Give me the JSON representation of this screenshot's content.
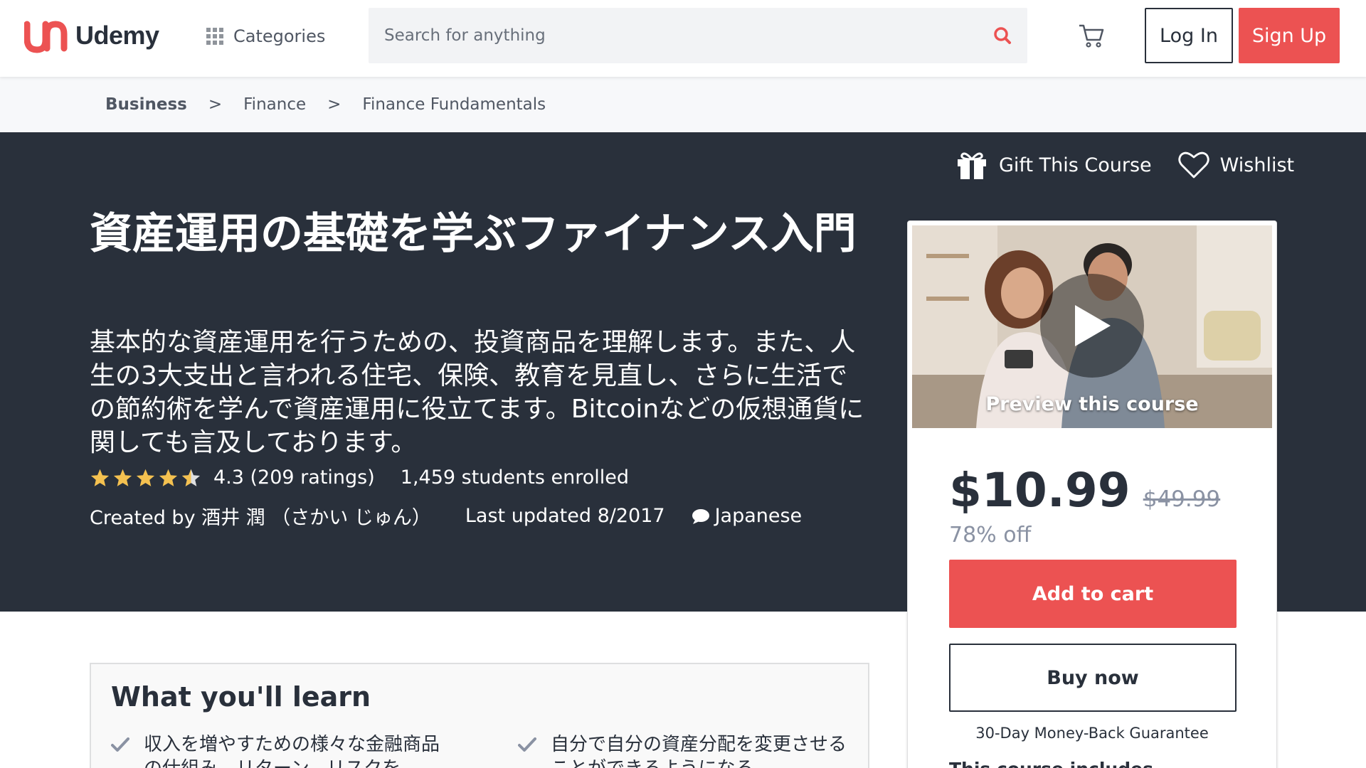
{
  "header": {
    "logo_text": "Udemy",
    "categories_label": "Categories",
    "search_placeholder": "Search for anything",
    "login_label": "Log In",
    "signup_label": "Sign Up"
  },
  "breadcrumb": [
    "Business",
    "Finance",
    "Finance Fundamentals"
  ],
  "hero": {
    "gift_label": "Gift This Course",
    "wishlist_label": "Wishlist",
    "title": "資産運用の基礎を学ぶファイナンス入門",
    "subtitle": "基本的な資産運用を行うための、投資商品を理解します。また、人生の3大支出と言われる住宅、保険、教育を見直し、さらに生活での節約術を学んで資産運用に役立てます。Bitcoinなどの仮想通貨に関しても言及しております。",
    "rating": 4.3,
    "rating_text": "4.3 (209 ratings)",
    "enrolled_text": "1,459 students enrolled",
    "created_by": "Created by 酒井 潤 （さかい じゅん）",
    "last_updated": "Last updated 8/2017",
    "language": "Japanese"
  },
  "card": {
    "preview_label": "Preview this course",
    "price": "$10.99",
    "original_price": "$49.99",
    "discount": "78% off",
    "add_to_cart": "Add to cart",
    "buy_now": "Buy now",
    "guarantee": "30-Day Money-Back Guarantee",
    "includes": "This course includes"
  },
  "learn": {
    "title": "What you'll learn",
    "items": [
      "収入を増やすための様々な金融商品の仕組み、リターン、リスクを",
      "自分で自分の資産分配を変更させることができるようになる"
    ]
  },
  "colors": {
    "brand": "#ec5252",
    "hero_bg": "#29303b",
    "star": "#f4c150"
  }
}
